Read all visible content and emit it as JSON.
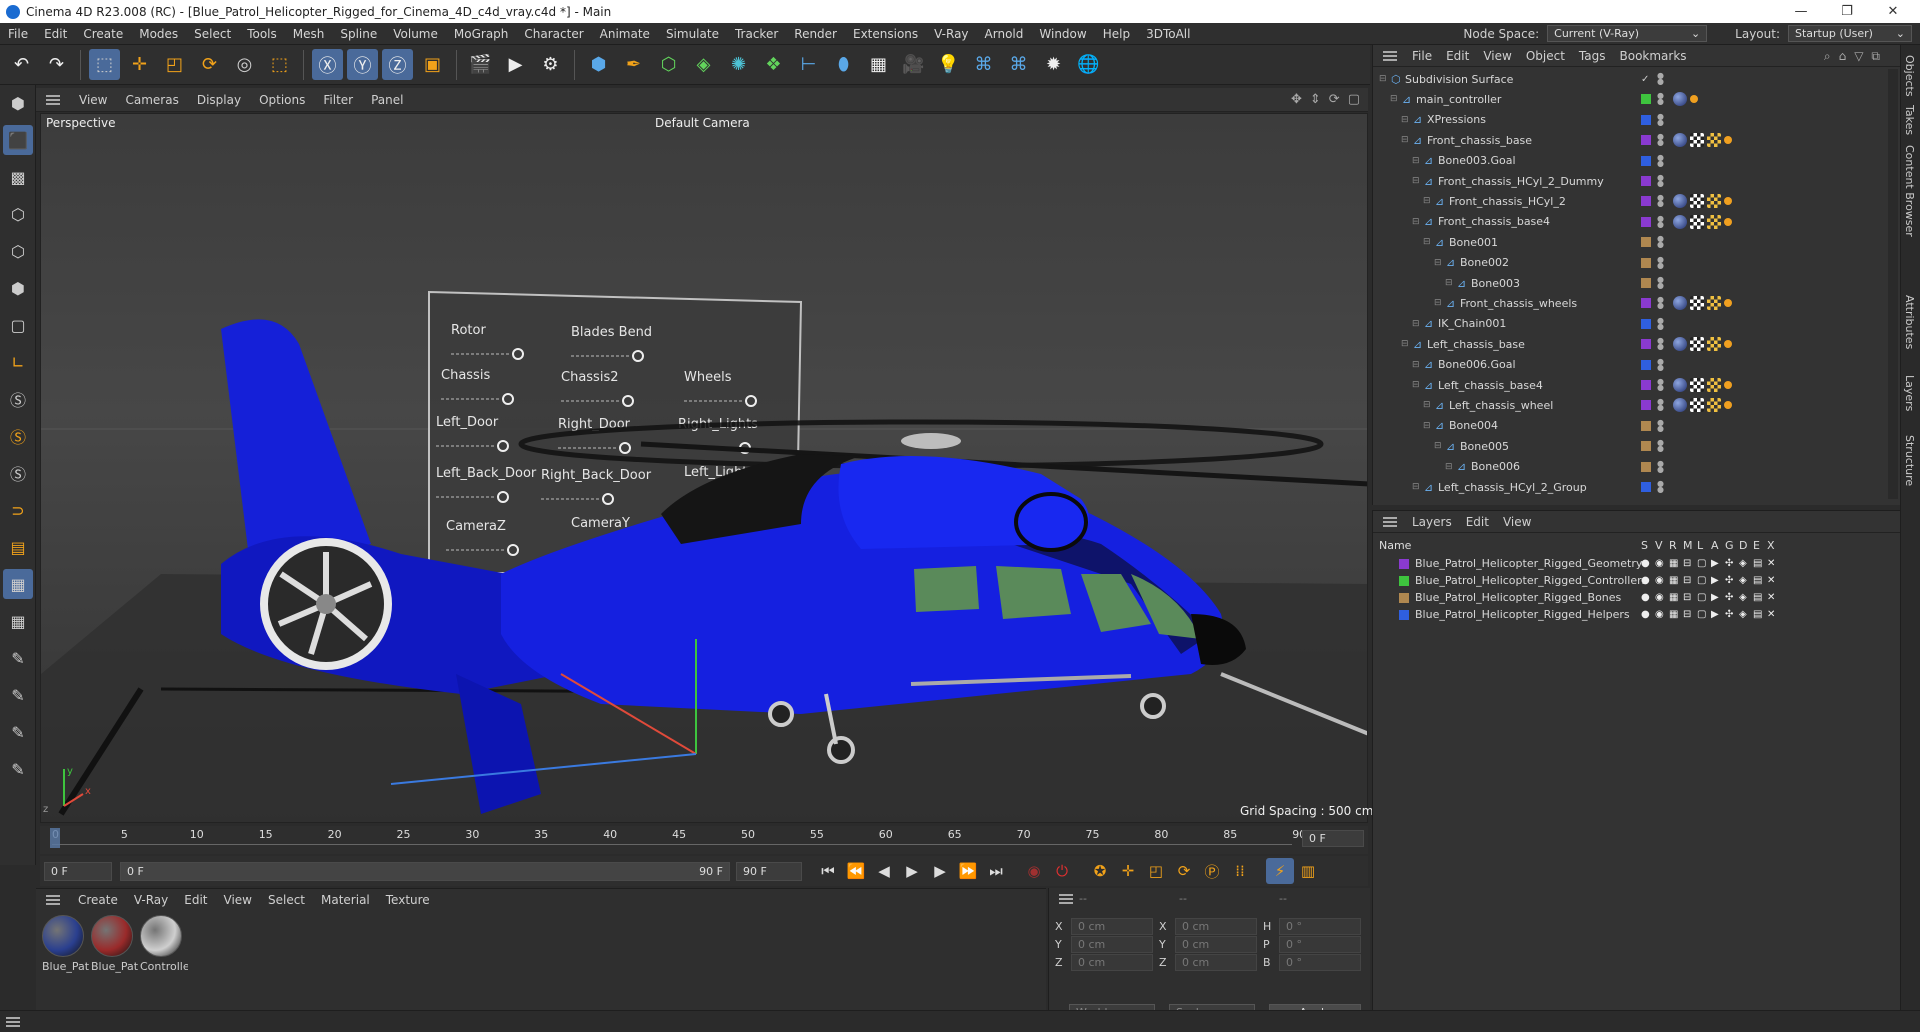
{
  "window": {
    "title": "Cinema 4D R23.008 (RC) - [Blue_Patrol_Helicopter_Rigged_for_Cinema_4D_c4d_vray.c4d *] - Main"
  },
  "menubar": {
    "items": [
      "File",
      "Edit",
      "Create",
      "Modes",
      "Select",
      "Tools",
      "Mesh",
      "Spline",
      "Volume",
      "MoGraph",
      "Character",
      "Animate",
      "Simulate",
      "Tracker",
      "Render",
      "Extensions",
      "V-Ray",
      "Arnold",
      "Window",
      "Help",
      "3DToAll"
    ],
    "node_space_label": "Node Space:",
    "node_space_value": "Current (V-Ray)",
    "layout_label": "Layout:",
    "layout_value": "Startup (User)"
  },
  "viewport": {
    "menu": [
      "View",
      "Cameras",
      "Display",
      "Options",
      "Filter",
      "Panel"
    ],
    "projection": "Perspective",
    "camera": "Default Camera",
    "grid_spacing": "Grid Spacing : 500 cm",
    "controller_labels": [
      "Rotor",
      "Blades Bend",
      "Chassis",
      "Chassis2",
      "Wheels",
      "Left_Door",
      "Right_Door",
      "Right_Lights",
      "Left_Back_Door",
      "Right_Back_Door",
      "Left_Lights",
      "CameraZ",
      "CameraY"
    ]
  },
  "timeline": {
    "ticks": [
      "0",
      "5",
      "10",
      "15",
      "20",
      "25",
      "30",
      "35",
      "40",
      "45",
      "50",
      "55",
      "60",
      "65",
      "70",
      "75",
      "80",
      "85",
      "90"
    ],
    "current_frame": "0 F",
    "start_field": "0 F",
    "range_start": "0 F",
    "range_end": "90 F",
    "end_field": "90 F"
  },
  "materials": {
    "menu": [
      "Create",
      "V-Ray",
      "Edit",
      "View",
      "Select",
      "Material",
      "Texture"
    ],
    "items": [
      {
        "label": "Blue_Pat",
        "color": "#2a3f8f"
      },
      {
        "label": "Blue_Pat",
        "color": "#9a2a2a"
      },
      {
        "label": "Controlle",
        "color": "#cfcfcf"
      }
    ]
  },
  "coordinates": {
    "header": [
      "--",
      "--",
      "--"
    ],
    "rows": [
      {
        "a": "X",
        "av": "0 cm",
        "b": "X",
        "bv": "0 cm",
        "c": "H",
        "cv": "0 °"
      },
      {
        "a": "Y",
        "av": "0 cm",
        "b": "Y",
        "bv": "0 cm",
        "c": "P",
        "cv": "0 °"
      },
      {
        "a": "Z",
        "av": "0 cm",
        "b": "Z",
        "bv": "0 cm",
        "c": "B",
        "cv": "0 °"
      }
    ],
    "world": "World",
    "scale": "Scale",
    "apply": "Apply"
  },
  "objects": {
    "menu": [
      "File",
      "Edit",
      "View",
      "Object",
      "Tags",
      "Bookmarks"
    ],
    "rows": [
      {
        "name": "Subdivision Surface",
        "indent": 0,
        "color": "",
        "tags": ""
      },
      {
        "name": "main_controller",
        "indent": 1,
        "color": "#3ec43e",
        "tags": "ph,or"
      },
      {
        "name": "XPressions",
        "indent": 2,
        "color": "#2f5fe0",
        "tags": ""
      },
      {
        "name": "Front_chassis_base",
        "indent": 2,
        "color": "#8a3ad0",
        "tags": "ph,cc,ck,or"
      },
      {
        "name": "Bone003.Goal",
        "indent": 3,
        "color": "#2f5fe0",
        "tags": ""
      },
      {
        "name": "Front_chassis_HCyl_2_Dummy",
        "indent": 3,
        "color": "#8a3ad0",
        "tags": ""
      },
      {
        "name": "Front_chassis_HCyl_2",
        "indent": 4,
        "color": "#8a3ad0",
        "tags": "ph,cc,ck,or"
      },
      {
        "name": "Front_chassis_base4",
        "indent": 3,
        "color": "#8a3ad0",
        "tags": "ph,cc,ck,or"
      },
      {
        "name": "Bone001",
        "indent": 4,
        "color": "#b08850",
        "tags": ""
      },
      {
        "name": "Bone002",
        "indent": 5,
        "color": "#b08850",
        "tags": ""
      },
      {
        "name": "Bone003",
        "indent": 6,
        "color": "#b08850",
        "tags": ""
      },
      {
        "name": "Front_chassis_wheels",
        "indent": 5,
        "color": "#8a3ad0",
        "tags": "ph,cc,ck,or"
      },
      {
        "name": "IK_Chain001",
        "indent": 3,
        "color": "#2f5fe0",
        "tags": ""
      },
      {
        "name": "Left_chassis_base",
        "indent": 2,
        "color": "#8a3ad0",
        "tags": "ph,cc,ck,or"
      },
      {
        "name": "Bone006.Goal",
        "indent": 3,
        "color": "#2f5fe0",
        "tags": ""
      },
      {
        "name": "Left_chassis_base4",
        "indent": 3,
        "color": "#8a3ad0",
        "tags": "ph,cc,ck,or"
      },
      {
        "name": "Left_chassis_wheel",
        "indent": 4,
        "color": "#8a3ad0",
        "tags": "ph,cc,ck,or"
      },
      {
        "name": "Bone004",
        "indent": 4,
        "color": "#b08850",
        "tags": ""
      },
      {
        "name": "Bone005",
        "indent": 5,
        "color": "#b08850",
        "tags": ""
      },
      {
        "name": "Bone006",
        "indent": 6,
        "color": "#b08850",
        "tags": ""
      },
      {
        "name": "Left_chassis_HCyl_2_Group",
        "indent": 3,
        "color": "#2f5fe0",
        "tags": ""
      }
    ]
  },
  "layers": {
    "menu": [
      "Layers",
      "Edit",
      "View"
    ],
    "header_name": "Name",
    "columns": [
      "S",
      "V",
      "R",
      "M",
      "L",
      "A",
      "G",
      "D",
      "E",
      "X"
    ],
    "rows": [
      {
        "name": "Blue_Patrol_Helicopter_Rigged_Geometry",
        "color": "#8a3ad0"
      },
      {
        "name": "Blue_Patrol_Helicopter_Rigged_Controllers",
        "color": "#3ec43e"
      },
      {
        "name": "Blue_Patrol_Helicopter_Rigged_Bones",
        "color": "#b08850"
      },
      {
        "name": "Blue_Patrol_Helicopter_Rigged_Helpers",
        "color": "#2f5fe0"
      }
    ]
  },
  "side_tabs": [
    "Objects",
    "Takes",
    "Content Browser",
    "Attributes",
    "Layers",
    "Structure"
  ]
}
